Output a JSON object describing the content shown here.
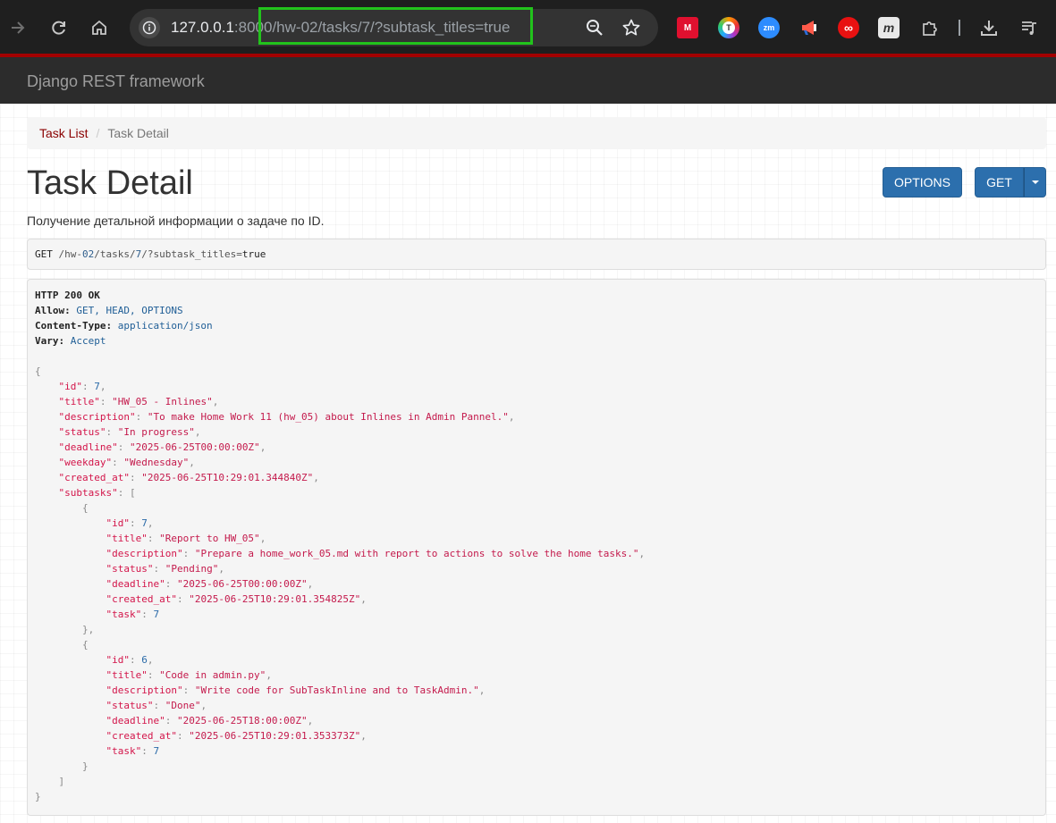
{
  "browser": {
    "url_host": "127.0.0.1",
    "url_port": ":8000",
    "url_path": "/hw-02/tasks/7/?subtask_titles=true"
  },
  "extensions": [
    {
      "name": "mendeley-extension-icon",
      "color": "#e0102f",
      "glyph": "M"
    },
    {
      "name": "translator-extension-icon",
      "color": "#ff9900",
      "glyph": "T"
    },
    {
      "name": "zoom-extension-icon",
      "color": "#2d8cff",
      "glyph": "zm"
    },
    {
      "name": "megaphone-extension-icon",
      "color": "#ff4747",
      "glyph": ""
    },
    {
      "name": "infinity-extension-icon",
      "color": "#e11",
      "glyph": "∞"
    },
    {
      "name": "m-extension-icon",
      "color": "#555555",
      "glyph": "m"
    }
  ],
  "navbar": {
    "brand": "Django REST framework"
  },
  "breadcrumb": {
    "link": "Task List",
    "separator": "/",
    "active": "Task Detail"
  },
  "page": {
    "title": "Task Detail",
    "description": "Получение детальной информации о задаче по ID.",
    "options_button": "OPTIONS",
    "get_button": "GET"
  },
  "request": {
    "method": "GET",
    "path_prefix": "/hw-",
    "path_num": "02",
    "path_mid": "/tasks/",
    "path_id": "7",
    "path_query": "/?subtask_titles",
    "path_eq": "=",
    "path_value": "true"
  },
  "response": {
    "status_line": "HTTP 200 OK",
    "headers": [
      {
        "name": "Allow:",
        "value": " GET, HEAD, OPTIONS"
      },
      {
        "name": "Content-Type:",
        "value": " application/json"
      },
      {
        "name": "Vary:",
        "value": " Accept"
      }
    ],
    "body": {
      "id": "7",
      "title": "\"HW_05 - Inlines\"",
      "description": "\"To make Home Work 11 (hw_05) about Inlines in Admin Pannel.\"",
      "status": "\"In progress\"",
      "deadline": "\"2025-06-25T00:00:00Z\"",
      "weekday": "\"Wednesday\"",
      "created_at": "\"2025-06-25T10:29:01.344840Z\"",
      "subtasks": [
        {
          "id": "7",
          "title": "\"Report to HW_05\"",
          "description": "\"Prepare a home_work_05.md with report to actions to solve the home tasks.\"",
          "status": "\"Pending\"",
          "deadline": "\"2025-06-25T00:00:00Z\"",
          "created_at": "\"2025-06-25T10:29:01.354825Z\"",
          "task": "7"
        },
        {
          "id": "6",
          "title": "\"Code in admin.py\"",
          "description": "\"Write code for SubTaskInline and to TaskAdmin.\"",
          "status": "\"Done\"",
          "deadline": "\"2025-06-25T18:00:00Z\"",
          "created_at": "\"2025-06-25T10:29:01.353373Z\"",
          "task": "7"
        }
      ]
    }
  }
}
